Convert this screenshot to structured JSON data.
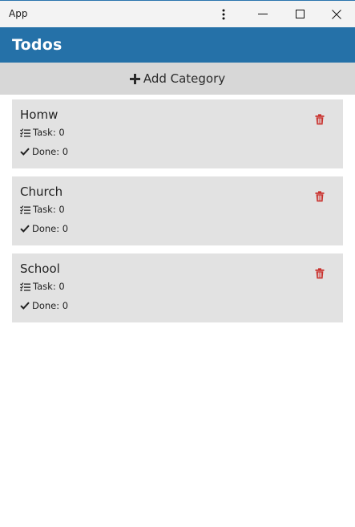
{
  "window": {
    "title": "App",
    "accent_color": "#2571a8"
  },
  "titlebar": {
    "icons": [
      "more-vertical-icon",
      "minimize-icon",
      "maximize-icon",
      "close-icon"
    ]
  },
  "appbar": {
    "title": "Todos"
  },
  "add_category": {
    "label": "Add Category",
    "icon": "plus-icon"
  },
  "categories": [
    {
      "name": "Homw",
      "task_label": "Task: 0",
      "done_label": "Done: 0"
    },
    {
      "name": "Church",
      "task_label": "Task: 0",
      "done_label": "Done: 0"
    },
    {
      "name": "School",
      "task_label": "Task: 0",
      "done_label": "Done: 0"
    }
  ],
  "colors": {
    "delete_icon": "#c9302c",
    "card_bg": "#e2e2e2",
    "add_bar_bg": "#d7d7d7"
  }
}
